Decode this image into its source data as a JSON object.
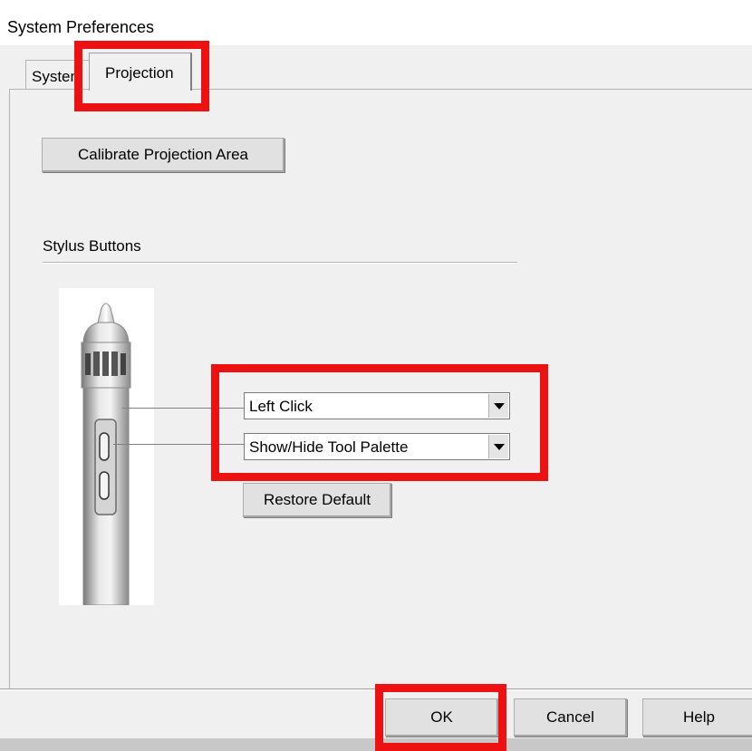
{
  "window": {
    "title": "System Preferences"
  },
  "tabs": [
    {
      "label": "System"
    },
    {
      "label": "Projection",
      "selected": true
    }
  ],
  "projection": {
    "calibrate_button": "Calibrate Projection Area",
    "stylus_group_label": "Stylus Buttons",
    "upper_button_action": {
      "selected": "Left Click"
    },
    "lower_button_action": {
      "selected": "Show/Hide Tool Palette"
    },
    "restore_button": "Restore Default"
  },
  "footer": {
    "ok": "OK",
    "cancel": "Cancel",
    "help": "Help"
  },
  "colors": {
    "highlight": "#ee1111",
    "window_bg": "#f0f0f0",
    "button_bg": "#e1e1e1"
  }
}
